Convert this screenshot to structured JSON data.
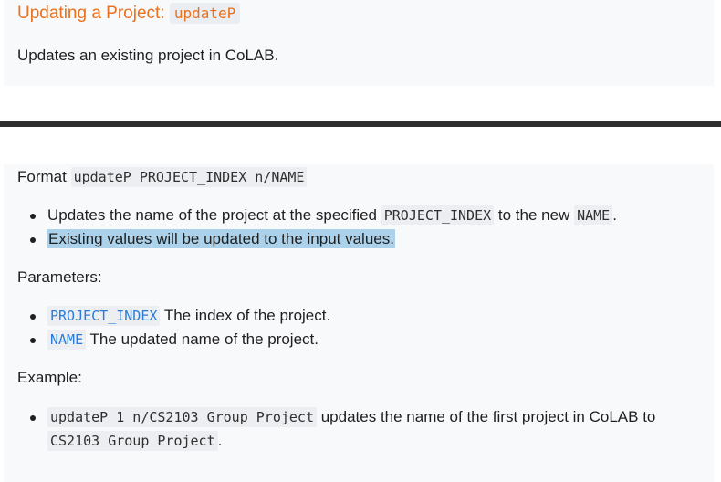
{
  "header": {
    "title": "Updating a Project:",
    "command": "updateP",
    "description": "Updates an existing project in CoLAB."
  },
  "format": {
    "label": "Format",
    "syntax": "updateP PROJECT_INDEX n/NAME",
    "bullets": [
      {
        "pre": "Updates the name of the project at the specified",
        "code1": "PROJECT_INDEX",
        "mid": "to the new",
        "code2": "NAME",
        "post": "."
      },
      {
        "text": "Existing values will be updated to the input values."
      }
    ]
  },
  "parameters": {
    "label": "Parameters:",
    "items": [
      {
        "code": "PROJECT_INDEX",
        "text": "The index of the project."
      },
      {
        "code": "NAME",
        "text": "The updated name of the project."
      }
    ]
  },
  "example": {
    "label": "Example:",
    "items": [
      {
        "code": "updateP 1 n/CS2103 Group Project",
        "text": "updates the name of the first project in CoLAB to",
        "code2": "CS2103 Group Project",
        "post": "."
      }
    ]
  }
}
